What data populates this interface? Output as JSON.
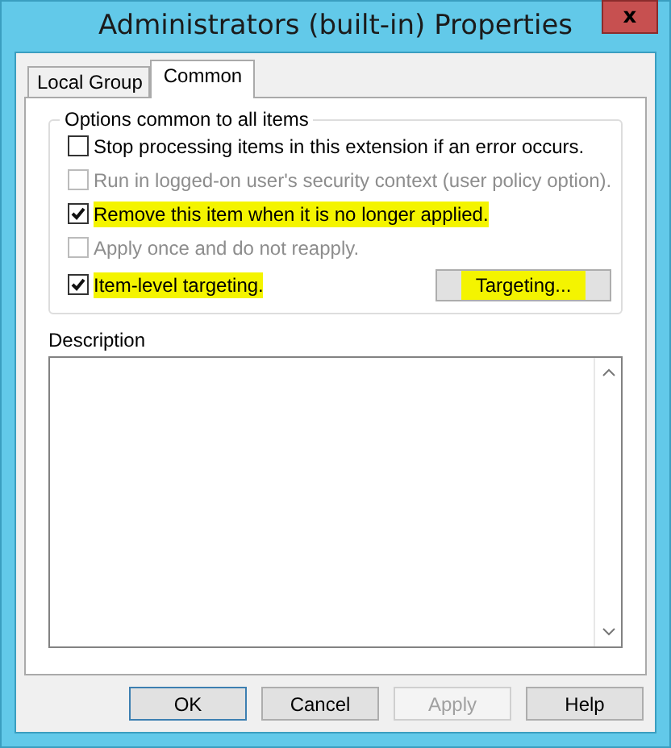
{
  "window": {
    "title": "Administrators (built-in) Properties",
    "close": "x"
  },
  "tabs": [
    {
      "label": "Local Group",
      "selected": false
    },
    {
      "label": "Common",
      "selected": true
    }
  ],
  "options_group": {
    "title": "Options common to all items",
    "options": [
      {
        "label": "Stop processing items in this extension if an error occurs.",
        "checked": false,
        "disabled": false,
        "highlighted": false
      },
      {
        "label": "Run in logged-on user's security context (user policy option).",
        "checked": false,
        "disabled": true,
        "highlighted": false
      },
      {
        "label": "Remove this item when it is no longer applied.",
        "checked": true,
        "disabled": false,
        "highlighted": true
      },
      {
        "label": "Apply once and do not reapply.",
        "checked": false,
        "disabled": true,
        "highlighted": false
      },
      {
        "label": "Item-level targeting.",
        "checked": true,
        "disabled": false,
        "highlighted": true
      }
    ],
    "targeting_button": {
      "label": "Targeting...",
      "highlighted": true
    }
  },
  "description": {
    "label": "Description"
  },
  "buttons": [
    {
      "label": "OK",
      "disabled": false,
      "default": true
    },
    {
      "label": "Cancel",
      "disabled": false,
      "default": false
    },
    {
      "label": "Apply",
      "disabled": true,
      "default": false
    },
    {
      "label": "Help",
      "disabled": false,
      "default": false
    }
  ]
}
